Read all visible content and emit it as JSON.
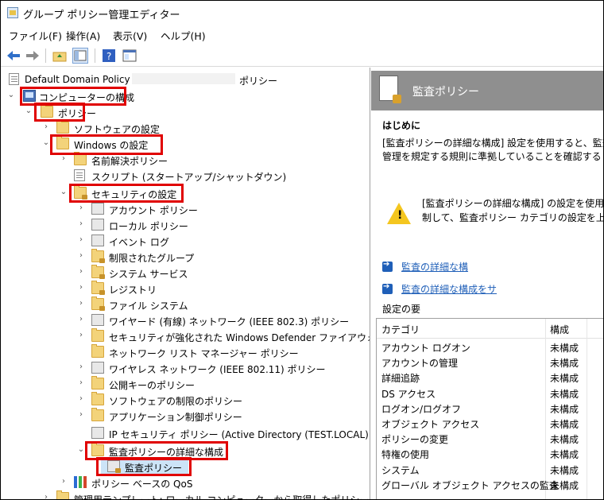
{
  "window": {
    "title": "グループ ポリシー管理エディター"
  },
  "menu": [
    "ファイル(F)",
    "操作(A)",
    "表示(V)",
    "ヘルプ(H)"
  ],
  "tree": {
    "root_label": "Default Domain Policy",
    "root_suffix": "ポリシー",
    "items": [
      {
        "label": "コンピューターの構成"
      },
      {
        "label": "ポリシー"
      },
      {
        "label": "ソフトウェアの設定"
      },
      {
        "label": "Windows の設定"
      },
      {
        "label": "名前解決ポリシー"
      },
      {
        "label": "スクリプト (スタートアップ/シャットダウン)"
      },
      {
        "label": "セキュリティの設定"
      },
      {
        "label": "アカウント ポリシー"
      },
      {
        "label": "ローカル ポリシー"
      },
      {
        "label": "イベント ログ"
      },
      {
        "label": "制限されたグループ"
      },
      {
        "label": "システム サービス"
      },
      {
        "label": "レジストリ"
      },
      {
        "label": "ファイル システム"
      },
      {
        "label": "ワイヤード (有線) ネットワーク (IEEE 802.3) ポリシー"
      },
      {
        "label": "セキュリティが強化された Windows Defender ファイアウォール"
      },
      {
        "label": "ネットワーク リスト マネージャー ポリシー"
      },
      {
        "label": "ワイヤレス ネットワーク (IEEE 802.11) ポリシー"
      },
      {
        "label": "公開キーのポリシー"
      },
      {
        "label": "ソフトウェアの制限のポリシー"
      },
      {
        "label": "アプリケーション制御ポリシー"
      },
      {
        "label": "IP セキュリティ ポリシー (Active Directory (TEST.LOCAL))"
      },
      {
        "label": "監査ポリシーの詳細な構成"
      },
      {
        "label": "監査ポリシー"
      },
      {
        "label": "ポリシー ベースの QoS"
      },
      {
        "label": "管理用テンプレート: ローカル コンピューターから取得したポリシー定義 (ADN"
      }
    ]
  },
  "right": {
    "header_title": "監査ポリシー",
    "intro_heading": "はじめに",
    "intro_line1": "[監査ポリシーの詳細な構成] 設定を使用すると、監査",
    "intro_line2": "管理を規定する規則に準拠していることを確認する",
    "warning_line1": "[監査ポリシーの詳細な構成] の設定を使用",
    "warning_line2": "制して、監査ポリシー カテゴリの設定を上書",
    "link1": "監査の詳細な構",
    "link2": "監査の詳細な構成をサ",
    "summary_title": "設定の要",
    "table": {
      "col_category": "カテゴリ",
      "col_config": "構成",
      "rows": [
        {
          "category": "アカウント ログオン",
          "config": "未構成"
        },
        {
          "category": "アカウントの管理",
          "config": "未構成"
        },
        {
          "category": "詳細追跡",
          "config": "未構成"
        },
        {
          "category": "DS アクセス",
          "config": "未構成"
        },
        {
          "category": "ログオン/ログオフ",
          "config": "未構成"
        },
        {
          "category": "オブジェクト アクセス",
          "config": "未構成"
        },
        {
          "category": "ポリシーの変更",
          "config": "未構成"
        },
        {
          "category": "特権の使用",
          "config": "未構成"
        },
        {
          "category": "システム",
          "config": "未構成"
        },
        {
          "category": "グローバル オブジェクト アクセスの監査",
          "config": "未構成"
        }
      ]
    }
  }
}
